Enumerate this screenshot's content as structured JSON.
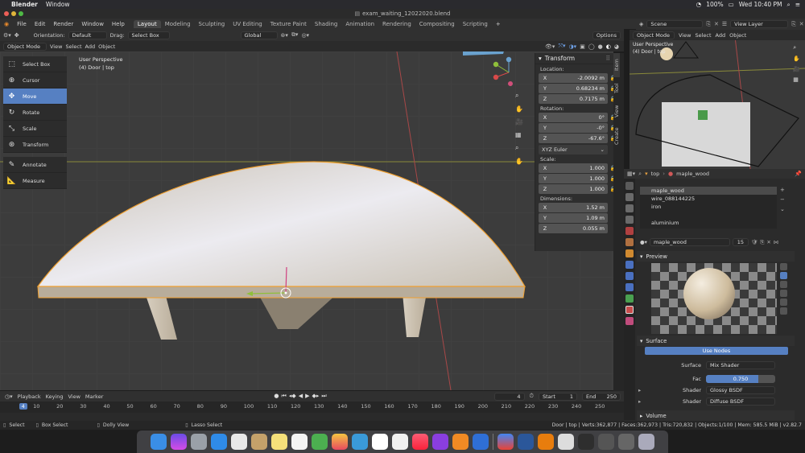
{
  "macos": {
    "app": "Blender",
    "menu": [
      "Window"
    ],
    "battery": "100%",
    "clock": "Wed 10:40 PM"
  },
  "window_title": "exam_waiting_12022020.blend",
  "menu": [
    "File",
    "Edit",
    "Render",
    "Window",
    "Help"
  ],
  "workspaces": [
    "Layout",
    "Modeling",
    "Sculpting",
    "UV Editing",
    "Texture Paint",
    "Shading",
    "Animation",
    "Rendering",
    "Compositing",
    "Scripting"
  ],
  "active_workspace": "Layout",
  "header": {
    "orientation_label": "Orientation:",
    "orientation": "Default",
    "drag_label": "Drag:",
    "drag": "Select Box",
    "transform_orientation": "Global",
    "options": "Options"
  },
  "header2": {
    "mode": "Object Mode",
    "items": [
      "View",
      "Select",
      "Add",
      "Object"
    ]
  },
  "tools": [
    {
      "label": "Select Box",
      "icon": "select-box-icon",
      "glyph": "⬚"
    },
    {
      "label": "Cursor",
      "icon": "cursor-icon",
      "glyph": "⊕"
    },
    {
      "label": "Move",
      "icon": "move-icon",
      "glyph": "✥",
      "active": true
    },
    {
      "label": "Rotate",
      "icon": "rotate-icon",
      "glyph": "↻"
    },
    {
      "label": "Scale",
      "icon": "scale-icon",
      "glyph": "⤡"
    },
    {
      "label": "Transform",
      "icon": "transform-icon",
      "glyph": "⊛"
    },
    {
      "label": "Annotate",
      "icon": "annotate-icon",
      "glyph": "✎"
    },
    {
      "label": "Measure",
      "icon": "measure-icon",
      "glyph": "📐"
    }
  ],
  "viewport": {
    "perspective": "User Perspective",
    "object": "(4) Door | top"
  },
  "n_panel": {
    "title": "Transform",
    "location_label": "Location:",
    "location": [
      {
        "axis": "X",
        "value": "-2.0092 m"
      },
      {
        "axis": "Y",
        "value": "0.68234 m"
      },
      {
        "axis": "Z",
        "value": "0.7175 m"
      }
    ],
    "rotation_label": "Rotation:",
    "rotation": [
      {
        "axis": "X",
        "value": "0°"
      },
      {
        "axis": "Y",
        "value": "-0°"
      },
      {
        "axis": "Z",
        "value": "-67.6°"
      }
    ],
    "rotation_mode": "XYZ Euler",
    "scale_label": "Scale:",
    "scale": [
      {
        "axis": "X",
        "value": "1.000"
      },
      {
        "axis": "Y",
        "value": "1.000"
      },
      {
        "axis": "Z",
        "value": "1.000"
      }
    ],
    "dimensions_label": "Dimensions:",
    "dimensions": [
      {
        "axis": "X",
        "value": "1.52 m"
      },
      {
        "axis": "Y",
        "value": "1.09 m"
      },
      {
        "axis": "Z",
        "value": "0.055 m"
      }
    ],
    "tabs": [
      "Item",
      "Tool",
      "View",
      "Create"
    ]
  },
  "timeline": {
    "menu": [
      "Playback",
      "Keying",
      "View",
      "Marker"
    ],
    "current_frame": "4",
    "start_label": "Start",
    "start": "1",
    "end_label": "End",
    "end": "250",
    "ticks": [
      "4",
      "10",
      "20",
      "30",
      "40",
      "50",
      "60",
      "70",
      "80",
      "90",
      "100",
      "110",
      "120",
      "130",
      "140",
      "150",
      "160",
      "170",
      "180",
      "190",
      "200",
      "210",
      "220",
      "230",
      "240",
      "250"
    ]
  },
  "status": {
    "select": "Select",
    "box_select": "Box Select",
    "dolly": "Dolly View",
    "lasso": "Lasso Select",
    "stats": "Door | top | Verts:362,877 | Faces:362,973 | Tris:720,832 | Objects:1/100 | Mem: 585.5 MiB | v2.82.7"
  },
  "top_right": {
    "scene": "Scene",
    "view_layer": "View Layer"
  },
  "side_viewport": {
    "mode": "Object Mode",
    "items": [
      "View",
      "Select",
      "Add",
      "Object"
    ],
    "perspective": "User Perspective",
    "object": "(4) Door | top"
  },
  "properties": {
    "breadcrumb_object": "top",
    "breadcrumb_material": "maple_wood",
    "slots": [
      "maple_wood",
      "wire_088144225",
      "iron",
      "",
      "aluminium"
    ],
    "material_name": "maple_wood",
    "users": "15",
    "preview_label": "Preview",
    "surface_section": "Surface",
    "use_nodes": "Use Nodes",
    "surface_label": "Surface",
    "surface_value": "Mix Shader",
    "fac_label": "Fac",
    "fac_value": "0.750",
    "fac": 0.75,
    "shader1_label": "Shader",
    "shader1_value": "Glossy BSDF",
    "shader2_label": "Shader",
    "shader2_value": "Diffuse BSDF",
    "volume_section": "Volume"
  },
  "colors": {
    "accent": "#5680c2",
    "selection_outline": "#f0a030",
    "wood": "#d9d3c6"
  }
}
